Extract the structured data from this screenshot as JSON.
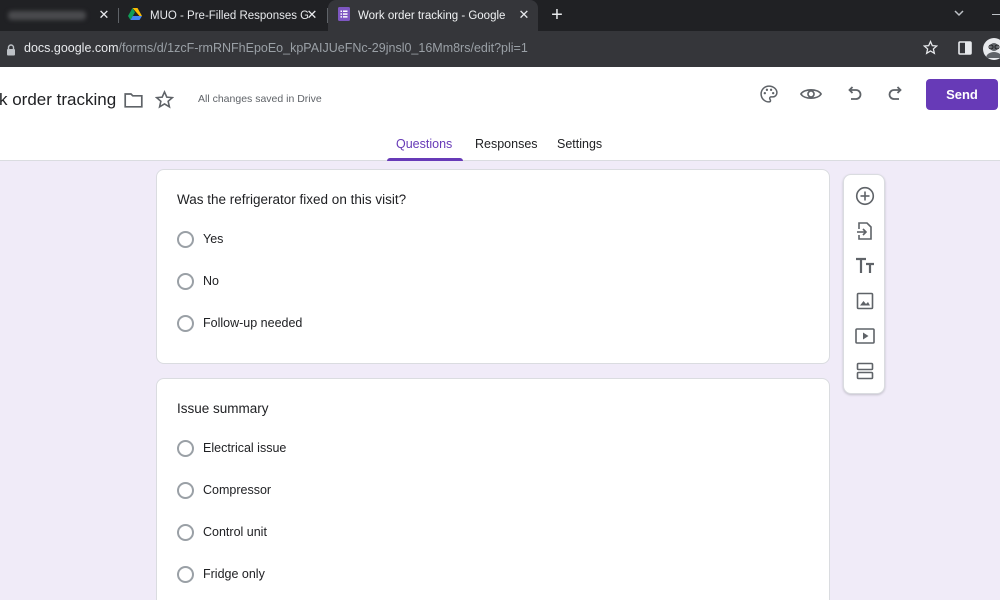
{
  "browser": {
    "tabs": [
      {
        "title": "",
        "favicon": "blurred-favicon"
      },
      {
        "title": "MUO - Pre-Filled Responses Google Forms",
        "favicon": "google-drive-icon"
      },
      {
        "title": "Work order tracking - Google Forms",
        "favicon": "google-forms-icon",
        "active": true
      }
    ],
    "url_host": "docs.google.com",
    "url_path": "/forms/d/1zcF-rmRNFhEpoEo_kpPAIJUeFNc-29jnsl0_16Mm8rs/edit?pli=1"
  },
  "form_header": {
    "title": "k order tracking",
    "save_status": "All changes saved in Drive",
    "send_label": "Send",
    "tabs": [
      "Questions",
      "Responses",
      "Settings"
    ],
    "active_tab": "Questions",
    "accent": "#673ab7"
  },
  "questions": [
    {
      "title": "Was the refrigerator fixed on this visit?",
      "options": [
        "Yes",
        "No",
        "Follow-up needed"
      ]
    },
    {
      "title": "Issue summary",
      "options": [
        "Electrical issue",
        "Compressor",
        "Control unit",
        "Fridge only"
      ]
    }
  ],
  "toolbar": [
    "add-question-icon",
    "import-questions-icon",
    "add-title-icon",
    "add-image-icon",
    "add-video-icon",
    "add-section-icon"
  ],
  "colors": {
    "background": "#f0ebf8",
    "chrome_dark": "#202124",
    "chrome_bar": "#35363a"
  }
}
